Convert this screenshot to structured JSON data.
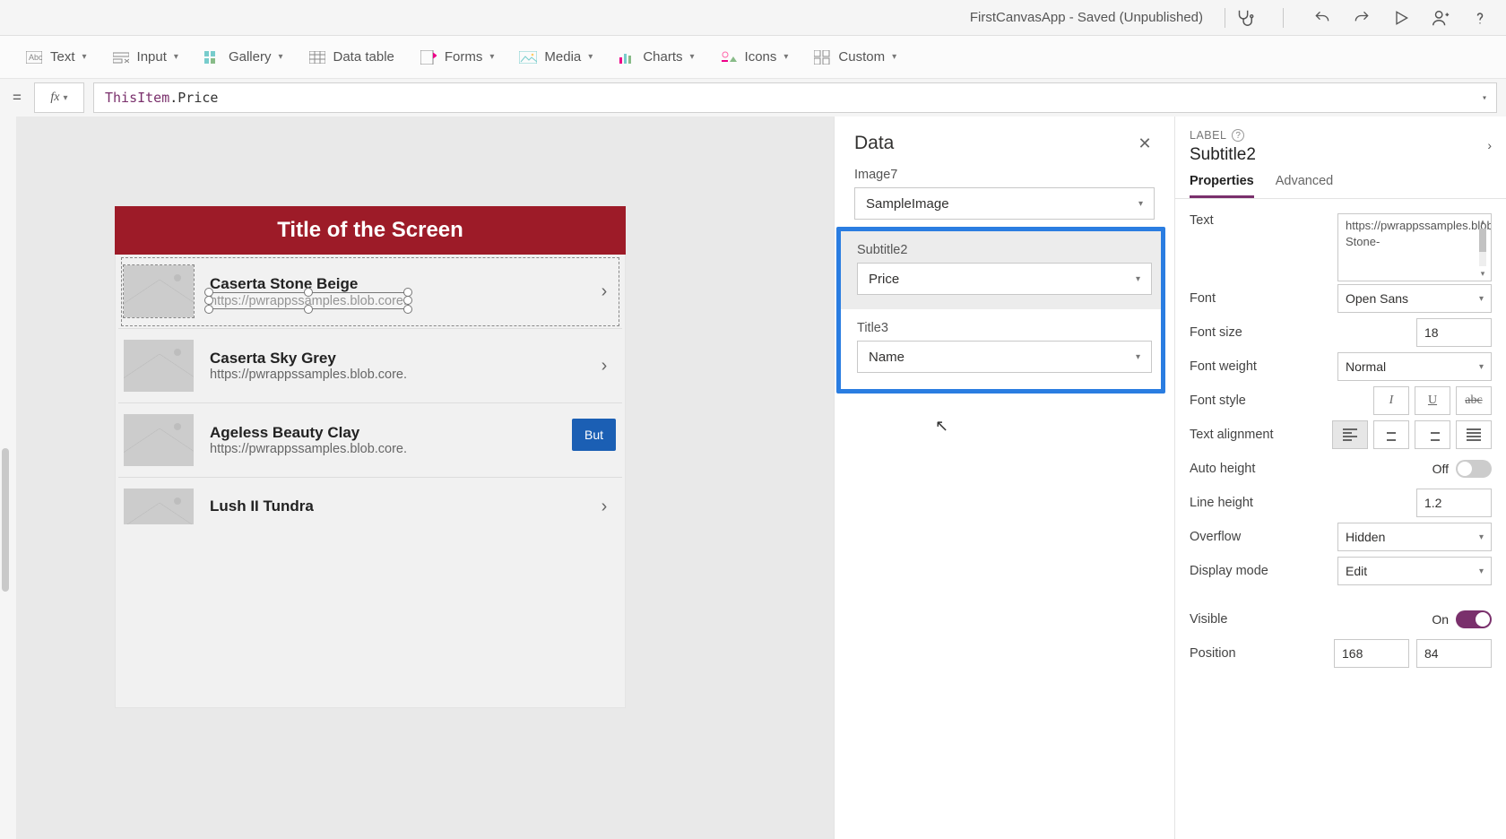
{
  "title_bar": {
    "app_title": "FirstCanvasApp - Saved (Unpublished)"
  },
  "ribbon": {
    "text": "Text",
    "input": "Input",
    "gallery": "Gallery",
    "data_table": "Data table",
    "forms": "Forms",
    "media": "Media",
    "charts": "Charts",
    "icons": "Icons",
    "custom": "Custom"
  },
  "formula": {
    "fx": "fx",
    "this": "ThisItem",
    "dot": ".",
    "prop": "Price"
  },
  "canvas": {
    "screen_title": "Title of the Screen",
    "button_label": "But",
    "items": [
      {
        "title": "Caserta Stone Beige",
        "subtitle": "https://pwrappssamples.blob.core."
      },
      {
        "title": "Caserta Sky Grey",
        "subtitle": "https://pwrappssamples.blob.core."
      },
      {
        "title": "Ageless Beauty Clay",
        "subtitle": "https://pwrappssamples.blob.core."
      },
      {
        "title": "Lush II Tundra",
        "subtitle": " "
      }
    ]
  },
  "data_panel": {
    "header": "Data",
    "image_label": "Image7",
    "image_value": "SampleImage",
    "subtitle_label": "Subtitle2",
    "subtitle_value": "Price",
    "title_label": "Title3",
    "title_value": "Name"
  },
  "props": {
    "kind": "LABEL",
    "element_name": "Subtitle2",
    "tabs": {
      "properties": "Properties",
      "advanced": "Advanced"
    },
    "rows": {
      "text": {
        "label": "Text",
        "value": "https://pwrappssamples.blob.core.windows.net/samples/AppFromDataImages/Carpet-Stone-"
      },
      "font": {
        "label": "Font",
        "value": "Open Sans"
      },
      "font_size": {
        "label": "Font size",
        "value": "18"
      },
      "font_weight": {
        "label": "Font weight",
        "value": "Normal"
      },
      "font_style": {
        "label": "Font style"
      },
      "text_align": {
        "label": "Text alignment"
      },
      "auto_height": {
        "label": "Auto height",
        "state": "Off"
      },
      "line_height": {
        "label": "Line height",
        "value": "1.2"
      },
      "overflow": {
        "label": "Overflow",
        "value": "Hidden"
      },
      "display_mode": {
        "label": "Display mode",
        "value": "Edit"
      },
      "visible": {
        "label": "Visible",
        "state": "On"
      },
      "position": {
        "label": "Position",
        "x": "168",
        "y": "84"
      }
    }
  }
}
